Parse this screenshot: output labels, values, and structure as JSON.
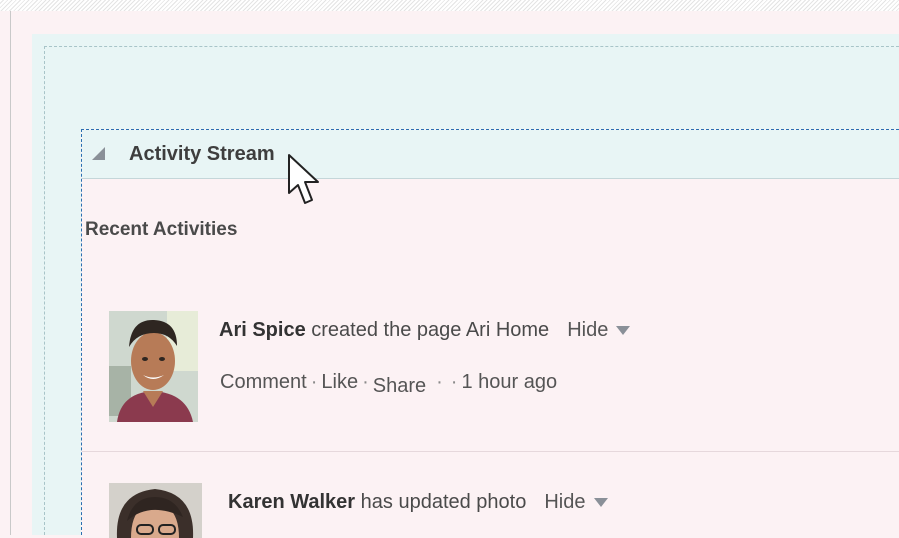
{
  "portlet": {
    "title": "Activity Stream",
    "collapse_icon": "collapse-triangle-icon"
  },
  "section": {
    "title": "Recent Activities"
  },
  "activities": [
    {
      "actor": "Ari Spice",
      "action": " created the page Ari Home",
      "hide_label": "Hide",
      "comment_label": "Comment",
      "like_label": "Like",
      "share_label": "Share",
      "separator": "·",
      "time": "1 hour ago",
      "avatar_icon": "user-avatar"
    },
    {
      "actor": "Karen Walker",
      "action": " has updated photo",
      "hide_label": "Hide",
      "avatar_icon": "user-avatar"
    }
  ],
  "colors": {
    "page_background": "#fcf2f4",
    "container_background": "#e8f5f5",
    "selection_border": "#2a6fb0"
  }
}
